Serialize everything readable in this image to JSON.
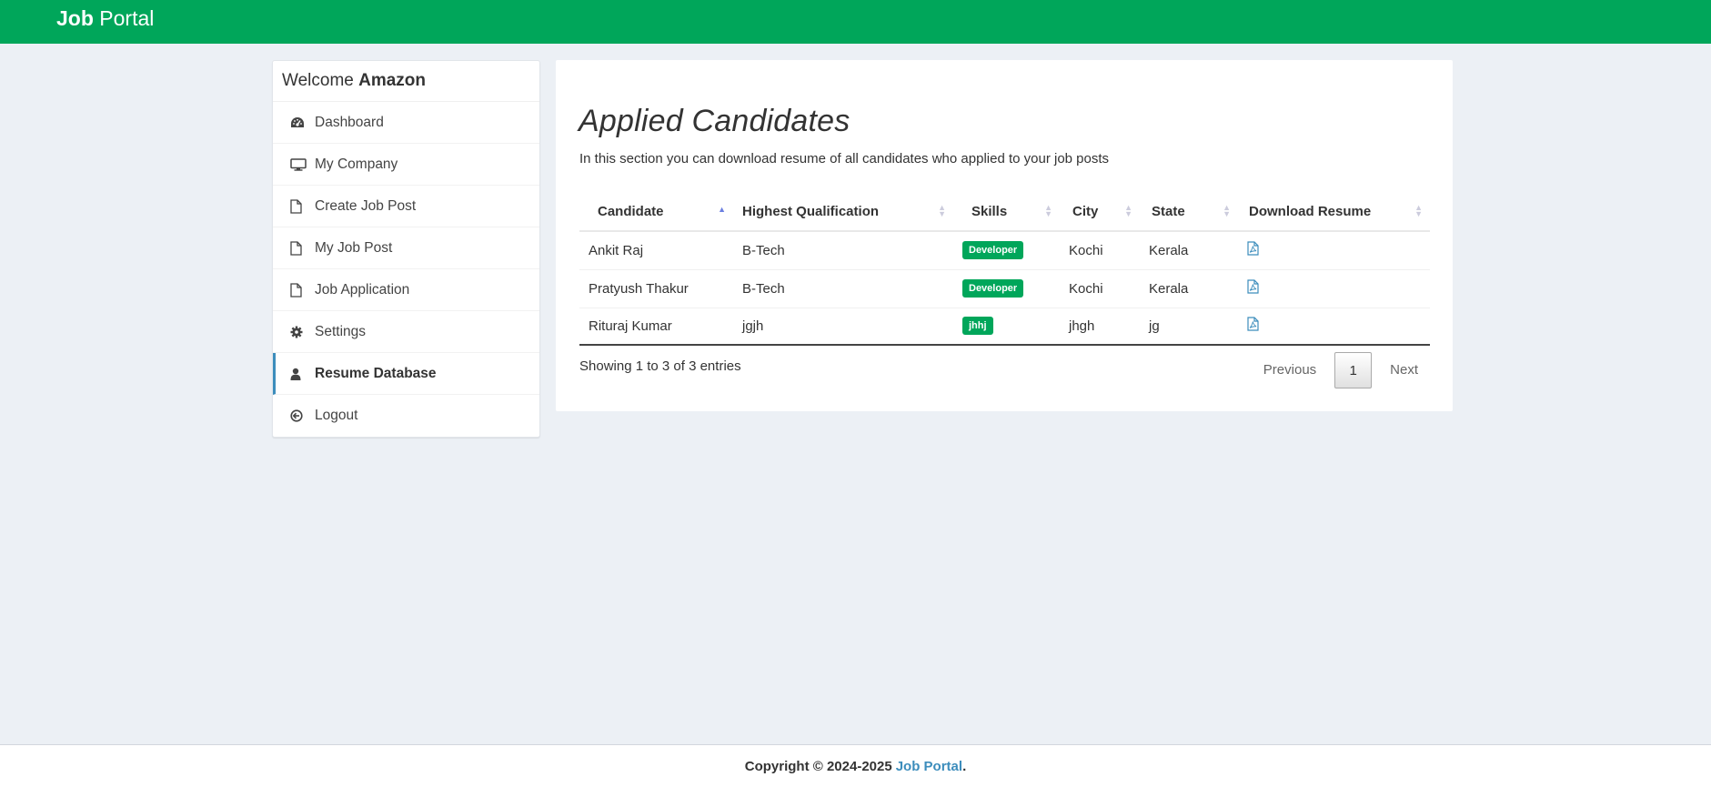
{
  "header": {
    "brand_bold": "Job",
    "brand_rest": "Portal"
  },
  "sidebar": {
    "welcome_prefix": "Welcome",
    "welcome_name": "Amazon",
    "items": [
      {
        "label": "Dashboard",
        "icon": "dashboard-icon"
      },
      {
        "label": "My Company",
        "icon": "desktop-icon"
      },
      {
        "label": "Create Job Post",
        "icon": "file-icon"
      },
      {
        "label": "My Job Post",
        "icon": "file-icon"
      },
      {
        "label": "Job Application",
        "icon": "file-icon"
      },
      {
        "label": "Settings",
        "icon": "gear-icon"
      },
      {
        "label": "Resume Database",
        "icon": "user-icon",
        "active": true
      },
      {
        "label": "Logout",
        "icon": "arrow-circle-icon"
      }
    ]
  },
  "main": {
    "title": "Applied Candidates",
    "subtitle": "In this section you can download resume of all candidates who applied to your job posts",
    "columns": [
      "Candidate",
      "Highest Qualification",
      "Skills",
      "City",
      "State",
      "Download Resume"
    ],
    "rows": [
      {
        "candidate": "Ankit Raj",
        "qualification": "B-Tech",
        "skill": "Developer",
        "city": "Kochi",
        "state": "Kerala",
        "resume_icon": "pdf-icon"
      },
      {
        "candidate": "Pratyush Thakur",
        "qualification": "B-Tech",
        "skill": "Developer",
        "city": "Kochi",
        "state": "Kerala",
        "resume_icon": "pdf-icon"
      },
      {
        "candidate": "Rituraj Kumar",
        "qualification": "jgjh",
        "skill": "jhhj",
        "city": "jhgh",
        "state": "jg",
        "resume_icon": "pdf-icon"
      }
    ],
    "info": "Showing 1 to 3 of 3 entries",
    "pagination": {
      "previous": "Previous",
      "current_page": "1",
      "next": "Next"
    }
  },
  "footer": {
    "copyright": "Copyright © 2024-2025",
    "link": "Job Portal",
    "period": "."
  },
  "colors": {
    "brand_green": "#00a65a",
    "link_blue": "#3c8dbc",
    "background": "#ecf0f5"
  }
}
